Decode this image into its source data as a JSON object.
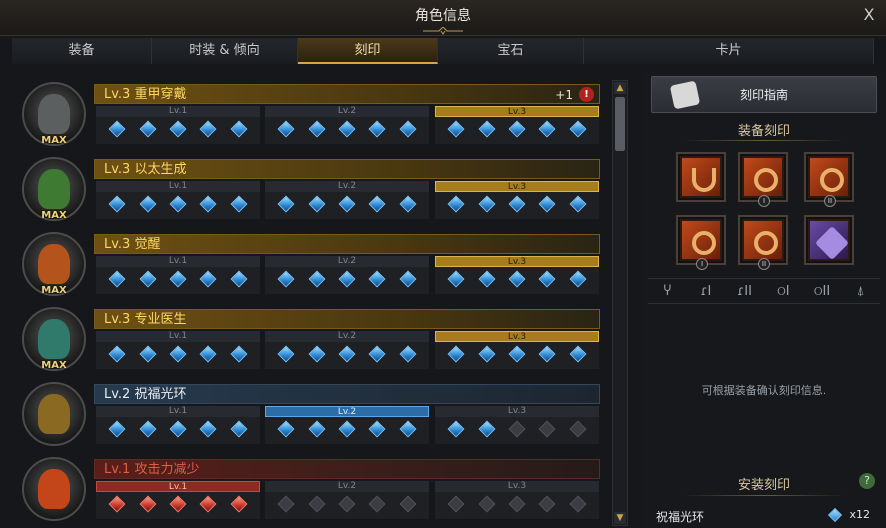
{
  "window": {
    "title": "角色信息",
    "close": "X"
  },
  "tabs": [
    "装备",
    "时装 & 倾向",
    "刻印",
    "宝石",
    "卡片"
  ],
  "active_tab": 2,
  "engravings": [
    {
      "name": "Lv.3 重甲穿戴",
      "level": 3,
      "max": true,
      "badge": "MAX",
      "bonus": "+1",
      "alert": "!",
      "style": "gold",
      "gems": [
        5,
        5,
        5
      ],
      "portrait_color": "#5c5f5f"
    },
    {
      "name": "Lv.3 以太生成",
      "level": 3,
      "max": true,
      "badge": "MAX",
      "style": "gold",
      "gems": [
        5,
        5,
        5
      ],
      "portrait_color": "#3f7a33"
    },
    {
      "name": "Lv.3 觉醒",
      "level": 3,
      "max": true,
      "badge": "MAX",
      "style": "gold",
      "gems": [
        5,
        5,
        5
      ],
      "portrait_color": "#b4531c"
    },
    {
      "name": "Lv.3 专业医生",
      "level": 3,
      "max": true,
      "badge": "MAX",
      "style": "gold",
      "gems": [
        5,
        5,
        5
      ],
      "portrait_color": "#2f7a6a"
    },
    {
      "name": "Lv.2 祝福光环",
      "level": 2,
      "max": false,
      "style": "blue",
      "gems": [
        5,
        5,
        2
      ],
      "portrait_color": "#8a6a22"
    },
    {
      "name": "Lv.1 攻击力减少",
      "level": 1,
      "max": false,
      "style": "red",
      "gems": [
        5,
        0,
        0
      ],
      "portrait_color": "#c2461a"
    }
  ],
  "level_labels": [
    "Lv.1",
    "Lv.2",
    "Lv.3"
  ],
  "side": {
    "guide_button": "刻印指南",
    "equip_header": "装备刻印",
    "slots": [
      {
        "type": "necklace",
        "roman": ""
      },
      {
        "type": "earring",
        "roman": "I"
      },
      {
        "type": "earring",
        "roman": "II"
      },
      {
        "type": "ring",
        "roman": "I"
      },
      {
        "type": "ring",
        "roman": "II"
      },
      {
        "type": "stone",
        "roman": ""
      }
    ],
    "filters": [
      "Ⴤ",
      "ɾI",
      "ɾII",
      "ଠI",
      "ଠII",
      "⍋"
    ],
    "note": "可根据装备确认刻印信息.",
    "install_header": "安装刻印",
    "help": "?",
    "installed": [
      {
        "name": "祝福光环",
        "count": "x12"
      }
    ]
  }
}
